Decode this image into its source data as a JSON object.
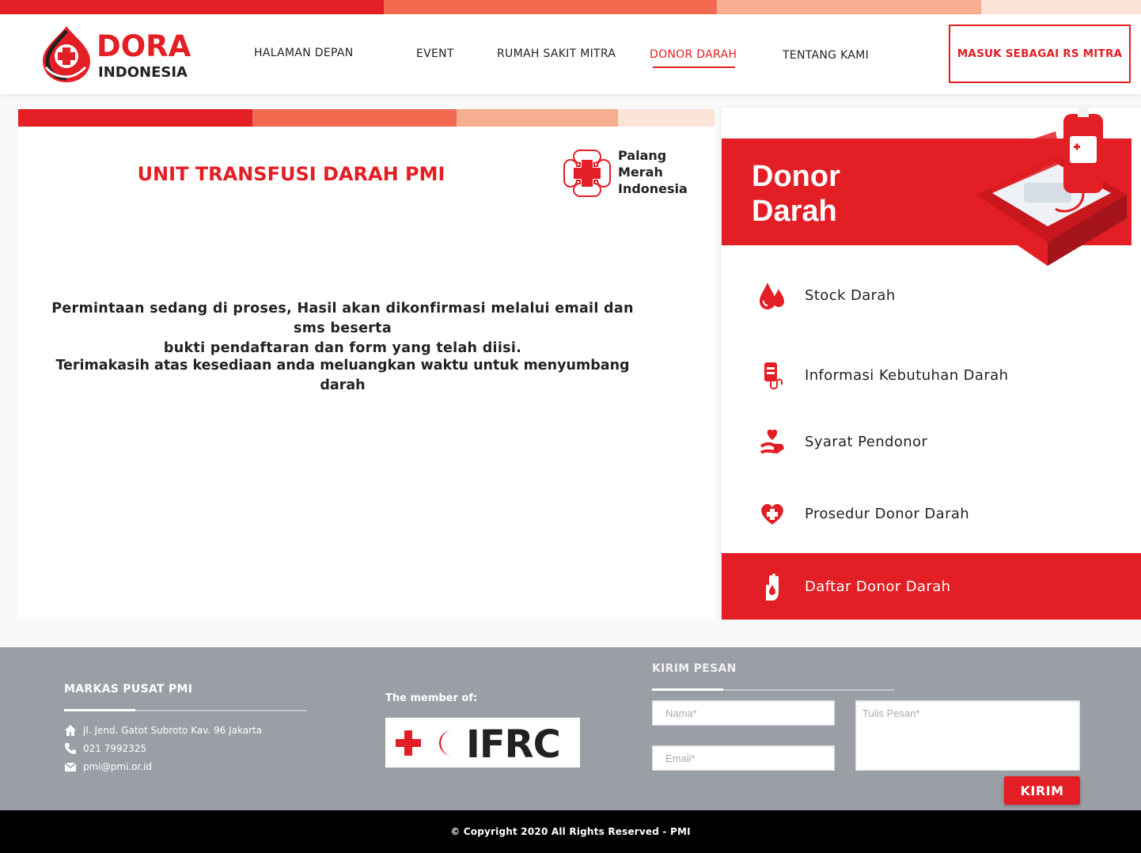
{
  "colors": {
    "brand_red": "#e31e24",
    "stripe": [
      "#e31e24",
      "#f26b50",
      "#f7ad8f",
      "#fde4d9"
    ],
    "footer_bg": "#9a9ea5",
    "copyright_bg": "#000000"
  },
  "header": {
    "logo_line1": "DORA",
    "logo_line2": "INDONESIA",
    "nav": [
      {
        "label": "HALAMAN DEPAN"
      },
      {
        "label": "EVENT"
      },
      {
        "label": "RUMAH SAKIT MITRA"
      },
      {
        "label": "DONOR DARAH",
        "active": true
      },
      {
        "label": "TENTANG KAMI"
      }
    ],
    "cta_label": "MASUK SEBAGAI RS MITRA"
  },
  "main": {
    "title": "UNIT TRANSFUSI DARAH PMI",
    "pmi_logo_lines": [
      "Palang",
      "Merah",
      "Indonesia"
    ],
    "message_line1": "Permintaan sedang di proses, Hasil akan dikonfirmasi melalui email dan sms beserta",
    "message_line2": "bukti pendaftaran dan form yang telah diisi.",
    "thanks": "Terimakasih atas kesediaan anda meluangkan waktu untuk menyumbang darah"
  },
  "sidebar": {
    "title_line1": "Donor",
    "title_line2": "Darah",
    "illustration": "blood-kit-illustration",
    "items": [
      {
        "label": "Stock Darah",
        "icon": "blood-drops-icon"
      },
      {
        "label": "Informasi Kebutuhan Darah",
        "icon": "blood-bag-icon"
      },
      {
        "label": "Syarat Pendonor",
        "icon": "heart-hand-icon"
      },
      {
        "label": "Prosedur Donor Darah",
        "icon": "heart-cross-icon"
      },
      {
        "label": "Daftar Donor Darah",
        "icon": "hand-drop-icon",
        "active": true
      }
    ]
  },
  "footer": {
    "hq_heading": "MARKAS PUSAT PMI",
    "address": "Jl. Jend. Gatot Subroto Kav. 96 Jakarta",
    "phone": "021 7992325",
    "email": "pmi@pmi.or.id",
    "member_label": "The member of:",
    "ifrc_text": "IFRC",
    "contact_heading": "KIRIM PESAN",
    "name_placeholder": "Nama*",
    "email_placeholder": "Email*",
    "message_placeholder": "Tulis Pesan*",
    "send_label": "KIRIM"
  },
  "copyright": "© Copyright 2020 All Rights Reserved - PMI"
}
